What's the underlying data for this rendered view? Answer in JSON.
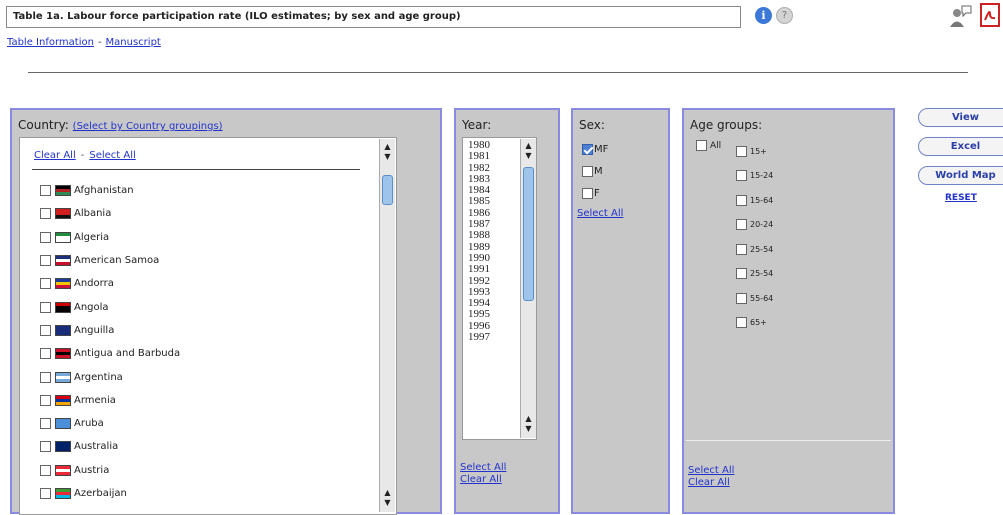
{
  "header": {
    "title": "Table 1a. Labour force participation rate (ILO estimates; by sex and age group)",
    "links": [
      "Table Information",
      "Manuscript"
    ],
    "link_separator": "-"
  },
  "country": {
    "label": "Country:",
    "groupings_link": "(Select by Country groupings)",
    "clear_all": "Clear All",
    "separator": "-",
    "select_all": "Select All",
    "items": [
      {
        "name": "Afghanistan",
        "flag": [
          "#000000",
          "#b22222",
          "#2e8b57"
        ]
      },
      {
        "name": "Albania",
        "flag": [
          "#d21f1f",
          "#d21f1f",
          "#111111"
        ]
      },
      {
        "name": "Algeria",
        "flag": [
          "#1e8e3e",
          "#ffffff",
          "#ffffff"
        ]
      },
      {
        "name": "American Samoa",
        "flag": [
          "#1c2f7a",
          "#ffffff",
          "#c8102e"
        ]
      },
      {
        "name": "Andorra",
        "flag": [
          "#1e3d9a",
          "#f5c400",
          "#d0103a"
        ]
      },
      {
        "name": "Angola",
        "flag": [
          "#cc0000",
          "#000000",
          "#000000"
        ]
      },
      {
        "name": "Anguilla",
        "flag": [
          "#1a2d7a",
          "#1a2d7a",
          "#1a2d7a"
        ]
      },
      {
        "name": "Antigua and Barbuda",
        "flag": [
          "#ce1126",
          "#000000",
          "#ce1126"
        ]
      },
      {
        "name": "Argentina",
        "flag": [
          "#75aadb",
          "#ffffff",
          "#75aadb"
        ]
      },
      {
        "name": "Armenia",
        "flag": [
          "#d90012",
          "#0033a0",
          "#f2a800"
        ]
      },
      {
        "name": "Aruba",
        "flag": [
          "#4a8fd8",
          "#4a8fd8",
          "#4a8fd8"
        ]
      },
      {
        "name": "Australia",
        "flag": [
          "#012169",
          "#012169",
          "#012169"
        ]
      },
      {
        "name": "Austria",
        "flag": [
          "#ed2939",
          "#ffffff",
          "#ed2939"
        ]
      },
      {
        "name": "Azerbaijan",
        "flag": [
          "#3f9c35",
          "#ed2939",
          "#00b9e4"
        ]
      }
    ]
  },
  "year": {
    "label": "Year:",
    "items": [
      "1980",
      "1981",
      "1982",
      "1983",
      "1984",
      "1985",
      "1986",
      "1987",
      "1988",
      "1989",
      "1990",
      "1991",
      "1992",
      "1993",
      "1994",
      "1995",
      "1996",
      "1997"
    ],
    "select_all": "Select All",
    "clear_all": "Clear All"
  },
  "sex": {
    "label": "Sex:",
    "items": [
      {
        "label": "MF",
        "checked": true
      },
      {
        "label": "M",
        "checked": false
      },
      {
        "label": "F",
        "checked": false
      }
    ],
    "select_all": "Select All"
  },
  "age": {
    "label": "Age groups:",
    "all_label": "All",
    "items": [
      "15+",
      "15-24",
      "15-64",
      "20-24",
      "25-54",
      "25-54",
      "55-64",
      "65+"
    ],
    "select_all": "Select All",
    "clear_all": "Clear All"
  },
  "actions": {
    "view": "View",
    "excel": "Excel",
    "world_map": "World Map",
    "reset": "RESET"
  }
}
